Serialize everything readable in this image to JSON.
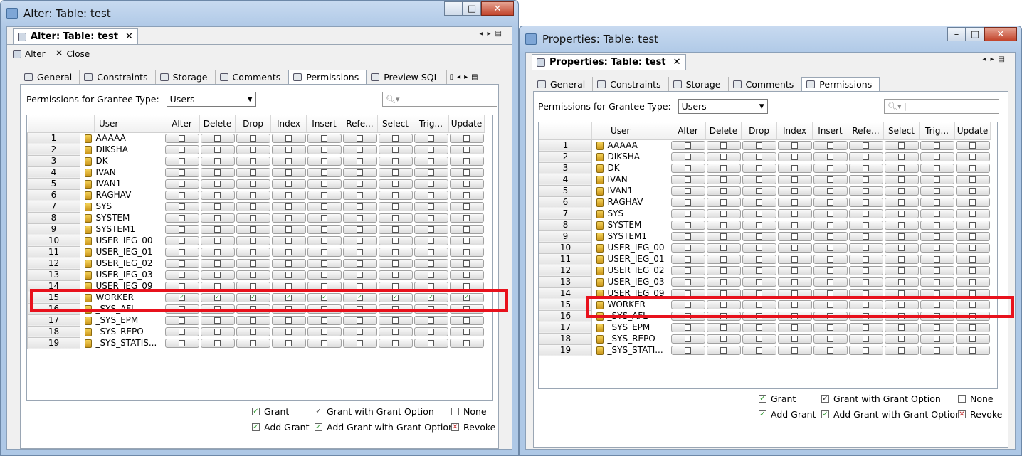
{
  "left": {
    "window_title": "Alter: Table: test",
    "editor_tab": "Alter: Table: test",
    "toolbar": {
      "alter": "Alter",
      "close": "Close"
    },
    "tabs": [
      "General",
      "Constraints",
      "Storage",
      "Comments",
      "Permissions",
      "Preview SQL"
    ],
    "active_tab": "Permissions",
    "grantee_label": "Permissions for Grantee Type:",
    "grantee_value": "Users",
    "columns": [
      "User",
      "Alter",
      "Delete",
      "Drop",
      "Index",
      "Insert",
      "Refe...",
      "Select",
      "Trig...",
      "Update"
    ],
    "rows": [
      "AAAAA",
      "DIKSHA",
      "DK",
      "IVAN",
      "IVAN1",
      "RAGHAV",
      "SYS",
      "SYSTEM",
      "SYSTEM1",
      "USER_IEG_00",
      "USER_IEG_01",
      "USER_IEG_02",
      "USER_IEG_03",
      "USER_IEG_09",
      "WORKER",
      "_SYS_AFL",
      "_SYS_EPM",
      "_SYS_REPO",
      "_SYS_STATIS..."
    ],
    "granted_row": 15,
    "legend": {
      "grant": "Grant",
      "grant_with_option": "Grant with Grant Option",
      "none": "None",
      "add_grant": "Add Grant",
      "add_grant_with_option": "Add Grant with Grant Option",
      "revoke": "Revoke"
    }
  },
  "right": {
    "window_title": "Properties: Table: test",
    "editor_tab": "Properties: Table: test",
    "tabs": [
      "General",
      "Constraints",
      "Storage",
      "Comments",
      "Permissions"
    ],
    "active_tab": "Permissions",
    "grantee_label": "Permissions for Grantee Type:",
    "grantee_value": "Users",
    "columns": [
      "User",
      "Alter",
      "Delete",
      "Drop",
      "Index",
      "Insert",
      "Refe...",
      "Select",
      "Trig...",
      "Update"
    ],
    "rows": [
      "AAAAA",
      "DIKSHA",
      "DK",
      "IVAN",
      "IVAN1",
      "RAGHAV",
      "SYS",
      "SYSTEM",
      "SYSTEM1",
      "USER_IEG_00",
      "USER_IEG_01",
      "USER_IEG_02",
      "USER_IEG_03",
      "USER_IEG_09",
      "WORKER",
      "_SYS_AFL",
      "_SYS_EPM",
      "_SYS_REPO",
      "_SYS_STATI..."
    ],
    "granted_row": 0,
    "legend": {
      "grant": "Grant",
      "grant_with_option": "Grant with Grant Option",
      "none": "None",
      "add_grant": "Add Grant",
      "add_grant_with_option": "Add Grant with Grant Option",
      "revoke": "Revoke"
    }
  }
}
